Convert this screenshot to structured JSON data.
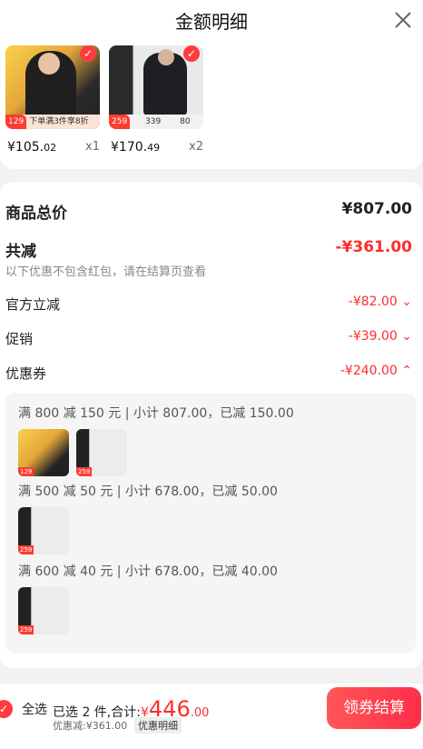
{
  "header": {
    "title": "金额明细"
  },
  "products": [
    {
      "tag_price": "129",
      "tag_text": "下单满3件享8折",
      "price_int": "¥105.",
      "price_dec": "02",
      "qty": "x1"
    },
    {
      "tag_price": "259",
      "tag_text": "339",
      "tag_text2": "80",
      "price_int": "¥170.",
      "price_dec": "49",
      "qty": "x2"
    }
  ],
  "summary": {
    "total_label": "商品总价",
    "total_value": "¥807.00",
    "reduce_label": "共减",
    "reduce_value": "-¥361.00",
    "reduce_note": "以下优惠不包含红包，请在结算页查看",
    "official_label": "官方立减",
    "official_value": "-¥82.00",
    "promo_label": "促销",
    "promo_value": "-¥39.00",
    "coupon_label": "优惠券",
    "coupon_value": "-¥240.00"
  },
  "coupon_groups": [
    {
      "title": "满 800 减 150 元 | 小计 807.00，已减 150.00",
      "thumb1_price": "129",
      "thumb1_text": "下单满3件享8折",
      "thumb2_price": "259"
    },
    {
      "title": "满 500 减 50 元 | 小计 678.00，已减 50.00",
      "thumb_price": "259"
    },
    {
      "title": "满 600 减 40 元 | 小计 678.00，已减 40.00",
      "thumb_price": "259"
    }
  ],
  "footer": {
    "select_all": "全选",
    "selected_text": "已选 2 件,合计:",
    "currency": "¥",
    "total_int": "446",
    "total_dec": ".00",
    "discount_text": "优惠减:¥361.00",
    "detail_btn": "优惠明细",
    "checkout": "领券结算"
  },
  "colors": {
    "accent": "#ff2d2d",
    "button": "#ff3b49"
  }
}
